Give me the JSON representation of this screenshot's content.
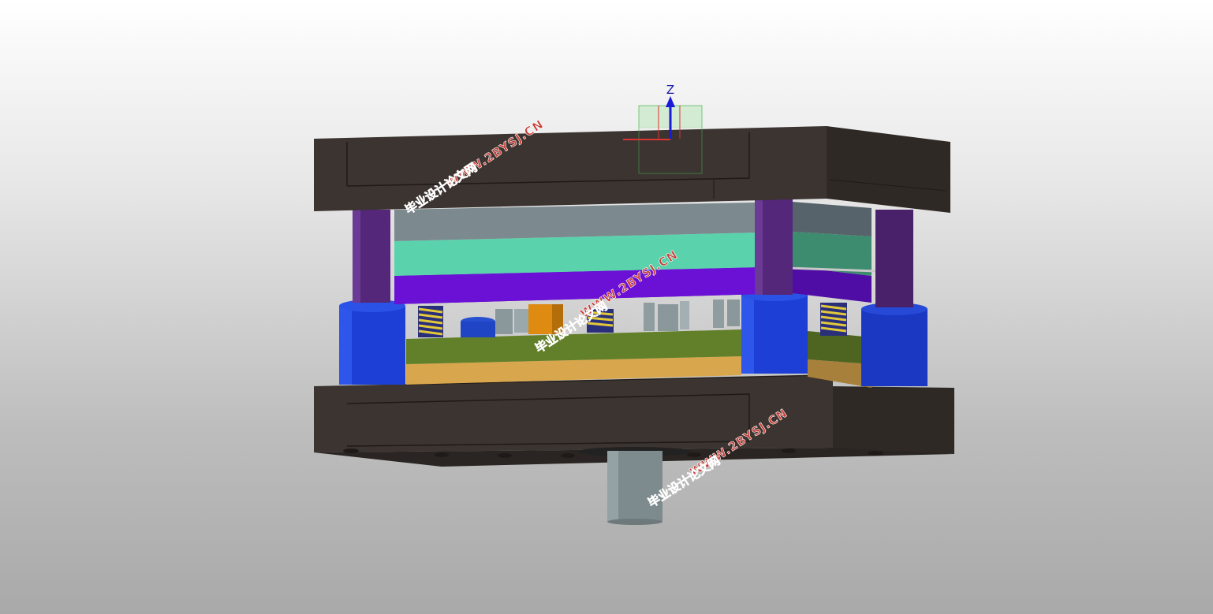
{
  "viewport": {
    "triad_axis_label": "Z",
    "colors": {
      "die_shoe": "#3a332f",
      "guide_post": "#54277a",
      "guide_bushing": "#1d3fd6",
      "plate_gray": "#7c8a90",
      "plate_teal": "#5ad3ad",
      "plate_violet": "#6b11d6",
      "plate_olive": "#62802a",
      "plate_tan": "#d8a64c",
      "spring": "#e2c93a",
      "pin_gray": "#8a989c",
      "block_orange": "#df8a10",
      "shank": "#7e8b8e"
    }
  },
  "watermarks": [
    {
      "line1": "WWW.2BYSJ.CN",
      "line2": "毕业设计论文网"
    },
    {
      "line1": "WWW.2BYSJ.CN",
      "line2": "毕业设计论文网"
    },
    {
      "line1": "WWW.2BYSJ.CN",
      "line2": "毕业设计论文网"
    }
  ]
}
